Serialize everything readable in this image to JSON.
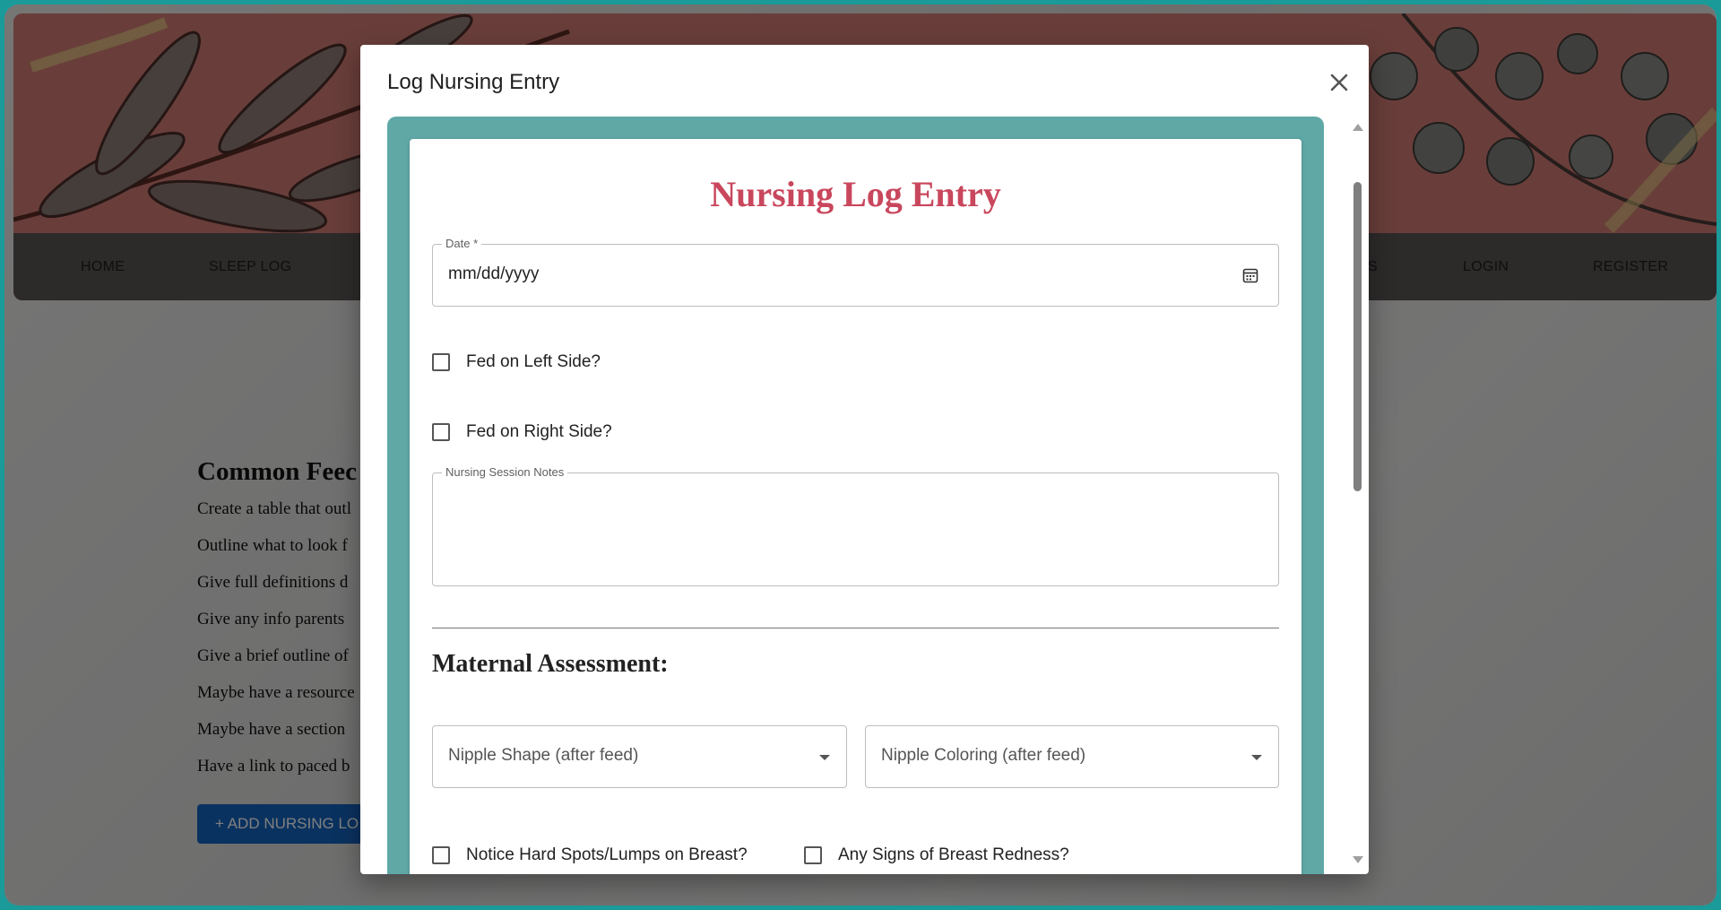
{
  "nav": {
    "items": [
      "HOME",
      "SLEEP LOG",
      "ES",
      "LOGIN",
      "REGISTER"
    ]
  },
  "page": {
    "heading": "Common Feec",
    "lines": [
      "Create a table that outl",
      "Outline what to look f",
      "Give full definitions d",
      "Give any info parents",
      "Give a brief outline of",
      "Maybe have a resource",
      "Maybe have a section",
      "Have a link to paced b"
    ],
    "add_button": "+ ADD NURSING LO"
  },
  "dialog": {
    "title": "Log Nursing Entry",
    "close_icon": "close-icon",
    "form": {
      "title": "Nursing Log Entry",
      "date": {
        "label": "Date *",
        "value": "mm/dd/yyyy",
        "icon": "calendar-icon"
      },
      "left_side": {
        "label": "Fed on Left Side?",
        "checked": false
      },
      "right_side": {
        "label": "Fed on Right Side?",
        "checked": false
      },
      "notes": {
        "label": "Nursing Session Notes",
        "value": ""
      },
      "maternal_heading": "Maternal Assessment:",
      "nipple_shape": {
        "placeholder": "Nipple Shape (after feed)"
      },
      "nipple_coloring": {
        "placeholder": "Nipple Coloring (after feed)"
      },
      "hard_spots": {
        "label": "Notice Hard Spots/Lumps on Breast?",
        "checked": false
      },
      "redness": {
        "label": "Any Signs of Breast Redness?",
        "checked": false
      }
    }
  },
  "colors": {
    "frame_teal": "#5fa8a6",
    "title_rose": "#c9475d",
    "banner_coral": "#d27d74",
    "navbar": "#5a5454",
    "button_blue": "#1565c0"
  }
}
